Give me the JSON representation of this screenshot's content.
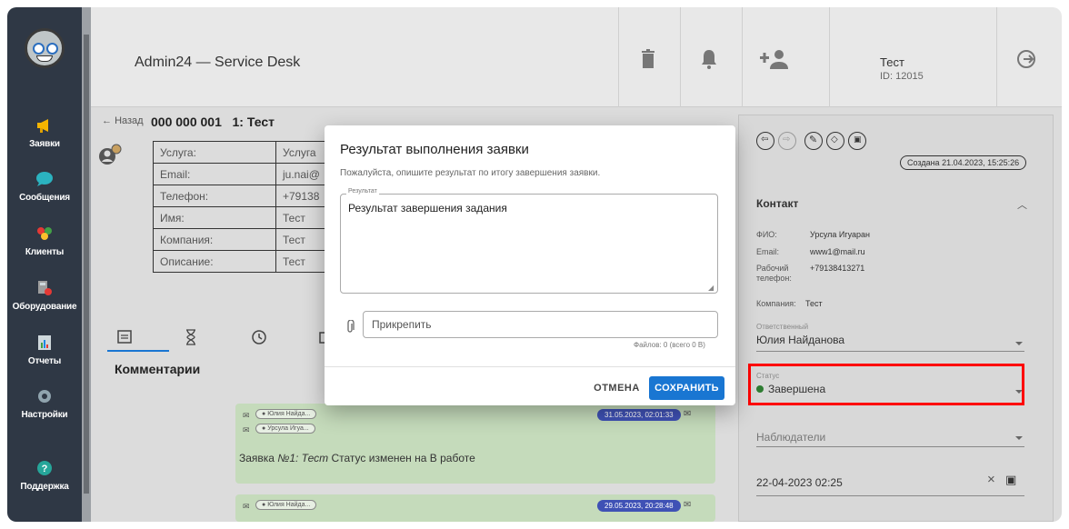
{
  "header": {
    "app_title": "Admin24 — Service Desk",
    "user_name": "Тест",
    "user_id": "ID: 12015"
  },
  "sidebar": {
    "items": [
      {
        "label": "Заявки",
        "icon": "megaphone-icon"
      },
      {
        "label": "Сообщения",
        "icon": "chat-icon"
      },
      {
        "label": "Клиенты",
        "icon": "users-icon"
      },
      {
        "label": "Оборудование",
        "icon": "equipment-icon"
      },
      {
        "label": "Отчеты",
        "icon": "report-icon"
      },
      {
        "label": "Настройки",
        "icon": "gear-icon"
      },
      {
        "label": "Поддержка",
        "icon": "help-icon"
      }
    ]
  },
  "ticket": {
    "back_label": "Назад",
    "title": "000 000 001   1: Тест",
    "info": [
      {
        "key": "Услуга:",
        "value": "Услуга"
      },
      {
        "key": "Email:",
        "value": "ju.nai@"
      },
      {
        "key": "Телефон:",
        "value": "+79138"
      },
      {
        "key": "Имя:",
        "value": "Тест"
      },
      {
        "key": "Компания:",
        "value": "Тест"
      },
      {
        "key": "Описание:",
        "value": "Тест"
      }
    ],
    "comments_title": "Комментарии",
    "comments": [
      {
        "from": "Юлия Найда...",
        "to": "Урсула Игуа...",
        "date": "31.05.2023, 02:01:33",
        "text_prefix": "Заявка ",
        "text_italic": "№1: Тест",
        "text_suffix": " Статус изменен на В работе"
      },
      {
        "from": "Юлия Найда...",
        "date": "29.05.2023, 20:28:48"
      }
    ]
  },
  "right_panel": {
    "created": "Создана 21.04.2023, 15:25:26",
    "contact_title": "Контакт",
    "contact": {
      "fio_label": "ФИО:",
      "fio": "Урсула Игуаран",
      "email_label": "Email:",
      "email": "www1@mail.ru",
      "phone_label_1": "Рабочий",
      "phone_label_2": "телефон:",
      "phone": "+79138413271",
      "company_label": "Компания:",
      "company": "Тест"
    },
    "responsible_label": "Ответственный",
    "responsible": "Юлия Найданова",
    "status_label": "Статус",
    "status": "Завершена",
    "status_color": "#2e7d32",
    "observers_label": "Наблюдатели",
    "date": "22-04-2023 02:25"
  },
  "modal": {
    "title": "Результат выполнения заявки",
    "subtitle": "Пожалуйста, опишите результат по итогу завершения заявки.",
    "result_label": "Результат",
    "result_value": "Результат завершения задания",
    "attach_placeholder": "Прикрепить",
    "files_info": "Файлов: 0 (всего 0 B)",
    "cancel_label": "ОТМЕНА",
    "save_label": "СОХРАНИТЬ"
  },
  "colors": {
    "sidebar_bg": "#2f3845",
    "accent": "#1976d2",
    "highlight": "#ff0000",
    "comment_bg": "#c5dbbb"
  }
}
